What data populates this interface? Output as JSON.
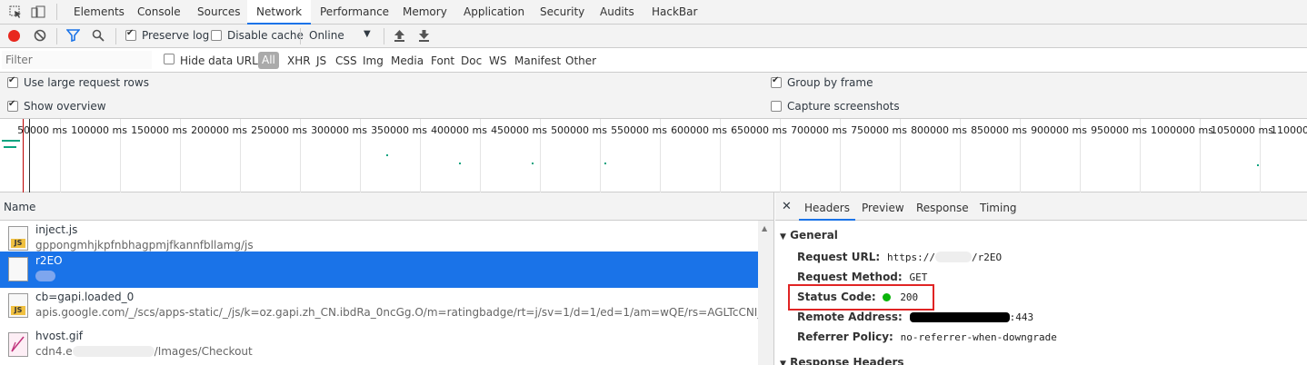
{
  "tabs": [
    "Elements",
    "Console",
    "Sources",
    "Network",
    "Performance",
    "Memory",
    "Application",
    "Security",
    "Audits",
    "HackBar"
  ],
  "active_tab": "Network",
  "toolbar": {
    "preserve_log": "Preserve log",
    "disable_cache": "Disable cache",
    "throttle": "Online",
    "preserve_log_checked": true,
    "disable_cache_checked": false
  },
  "filter": {
    "placeholder": "Filter",
    "hide_data_urls": "Hide data URLs",
    "types": [
      "All",
      "XHR",
      "JS",
      "CSS",
      "Img",
      "Media",
      "Font",
      "Doc",
      "WS",
      "Manifest",
      "Other"
    ]
  },
  "options": {
    "large_rows": "Use large request rows",
    "show_overview": "Show overview",
    "group_by_frame": "Group by frame",
    "capture_screenshots": "Capture screenshots"
  },
  "timeline_ticks": [
    "50000 ms",
    "100000 ms",
    "150000 ms",
    "200000 ms",
    "250000 ms",
    "300000 ms",
    "350000 ms",
    "400000 ms",
    "450000 ms",
    "500000 ms",
    "550000 ms",
    "600000 ms",
    "650000 ms",
    "700000 ms",
    "750000 ms",
    "800000 ms",
    "850000 ms",
    "900000 ms",
    "950000 ms",
    "1000000 ms",
    "1050000 ms",
    "1100000 m"
  ],
  "list": {
    "header": "Name",
    "rows": [
      {
        "name": "inject.js",
        "sub": "gppongmhjkpfnbhagpmjfkannfbllamg/js"
      },
      {
        "name": "r2EO",
        "sub": ""
      },
      {
        "name": "cb=gapi.loaded_0",
        "sub": "apis.google.com/_/scs/apps-static/_/js/k=oz.gapi.zh_CN.ibdRa_0ncGg.O/m=ratingbadge/rt=j/sv=1/d=1/ed=1/am=wQE/rs=AGLTcCNI_IHPueVrRlCujkk"
      },
      {
        "name": "hvost.gif",
        "sub_prefix": "cdn4.e",
        "sub_suffix": "/Images/Checkout"
      }
    ]
  },
  "detail": {
    "tabs": [
      "Headers",
      "Preview",
      "Response",
      "Timing"
    ],
    "general_title": "General",
    "request_url_label": "Request URL:",
    "request_url_prefix": "https://",
    "request_url_suffix": "/r2EO",
    "request_method_label": "Request Method:",
    "request_method": "GET",
    "status_code_label": "Status Code:",
    "status_code": "200",
    "remote_address_label": "Remote Address:",
    "remote_address_suffix": ":443",
    "referrer_policy_label": "Referrer Policy:",
    "referrer_policy": "no-referrer-when-downgrade",
    "response_headers_title": "Response Headers"
  },
  "colors": {
    "accent": "#1a73e8",
    "record": "#e8281e",
    "status_ok": "#0ab40a",
    "highlight_box": "#e02424"
  }
}
